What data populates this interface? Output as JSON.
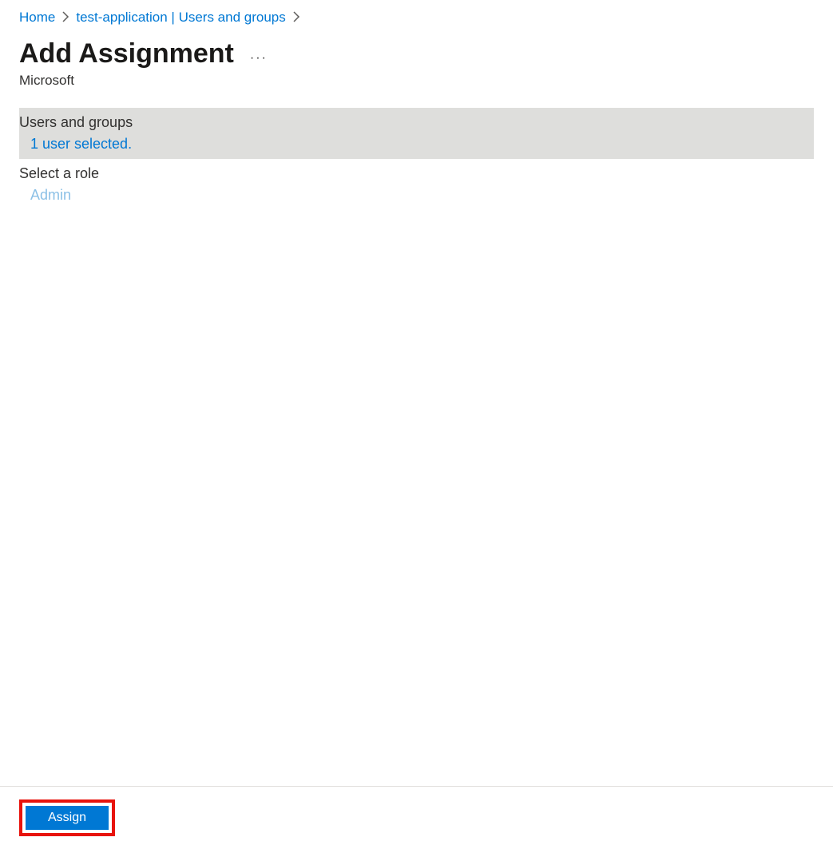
{
  "breadcrumb": {
    "home": "Home",
    "app": "test-application | Users and groups"
  },
  "header": {
    "title": "Add Assignment",
    "subtitle": "Microsoft"
  },
  "sections": {
    "users_groups": {
      "label": "Users and groups",
      "value": "1 user selected."
    },
    "select_role": {
      "label": "Select a role",
      "value": "Admin"
    }
  },
  "footer": {
    "assign_label": "Assign"
  }
}
